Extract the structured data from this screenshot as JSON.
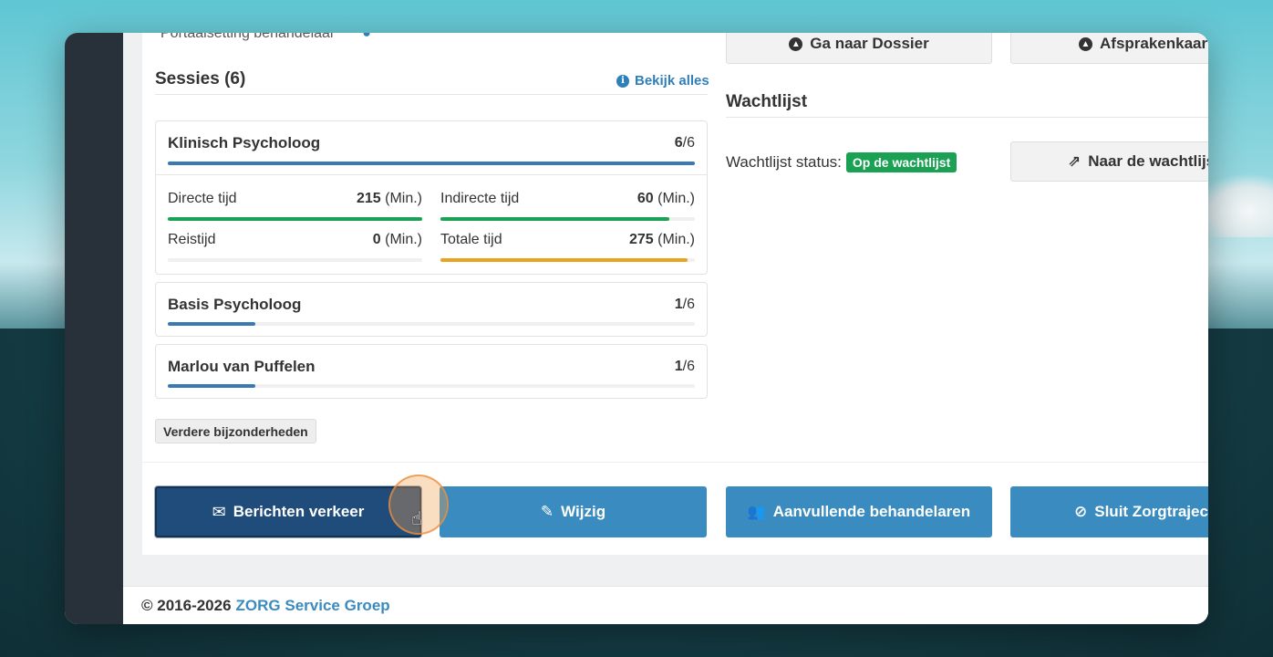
{
  "top_cut_text": "Portaalsetting behandelaar",
  "sessions": {
    "title": "Sessies (6)",
    "view_all": "Bekijk alles",
    "cards": [
      {
        "name": "Klinisch Psycholoog",
        "done": "6",
        "total": "/6",
        "progress": 1.0
      },
      {
        "name": "Basis Psycholoog",
        "done": "1",
        "total": "/6",
        "progress": 0.1667
      },
      {
        "name": "Marlou van Puffelen",
        "done": "1",
        "total": "/6",
        "progress": 0.1667
      }
    ],
    "stats": {
      "direct_label": "Directe tijd",
      "direct_value": "215",
      "direct_fill": 1.0,
      "indirect_label": "Indirecte tijd",
      "indirect_value": "60",
      "indirect_fill": 0.9,
      "travel_label": "Reistijd",
      "travel_value": "0",
      "travel_fill": 0,
      "total_label": "Totale tijd",
      "total_value": "275",
      "total_fill": 0.97,
      "unit": "(Min.)"
    },
    "details_button": "Verdere bijzonderheden"
  },
  "top_buttons": {
    "dossier": "Ga naar Dossier",
    "afspraken": "Afsprakenkaart"
  },
  "waitlist": {
    "title": "Wachtlijst",
    "status_label": "Wachtlijst status:",
    "status_badge": "Op de wachtlijst",
    "goto_button": "Naar de wachtlijst"
  },
  "actions": {
    "messages": "Berichten verkeer",
    "edit": "Wijzig",
    "additional": "Aanvullende behandelaren",
    "close": "Sluit Zorgtraject"
  },
  "footer": {
    "copyright": "© 2016-2026",
    "brand": "ZORG Service Groep"
  },
  "colors": {
    "primary": "#3a8bbf",
    "primary_dark": "#1f4c7b",
    "success": "#1aa154",
    "warning": "#e9a320",
    "bar_blue": "#3a7ab3"
  }
}
